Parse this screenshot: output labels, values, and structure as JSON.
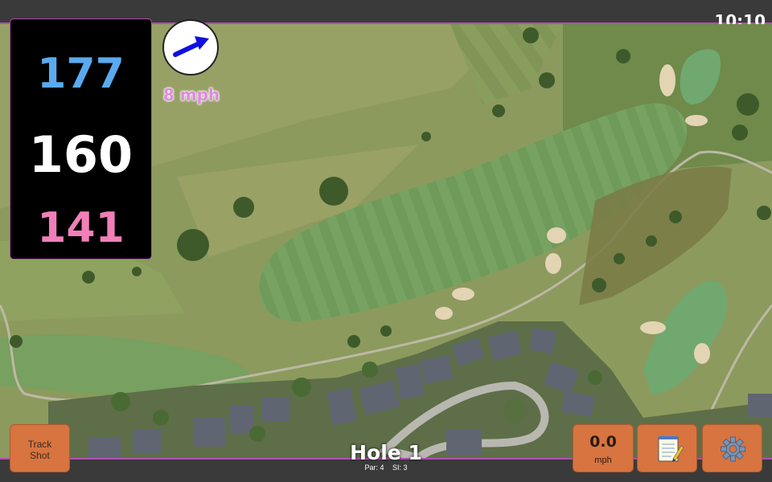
{
  "status": {
    "time": "10:10"
  },
  "distances": {
    "back": "177",
    "center": "160",
    "front": "141"
  },
  "wind": {
    "speed": "8 mph",
    "direction_icon": "wind-arrow-icon"
  },
  "buttons": {
    "track_shot": {
      "line1": "Track",
      "line2": "Shot"
    },
    "speed": {
      "value": "0.0",
      "unit": "mph"
    },
    "notes": {
      "icon": "notepad-icon"
    },
    "settings": {
      "icon": "gear-icon"
    }
  },
  "hole": {
    "title": "Hole 1",
    "par": "Par: 4",
    "si": "SI: 3"
  },
  "colors": {
    "back": "#5aaaf0",
    "center": "#ffffff",
    "front": "#f07fb8",
    "accent": "#b34fb3",
    "button": "#d77440"
  }
}
